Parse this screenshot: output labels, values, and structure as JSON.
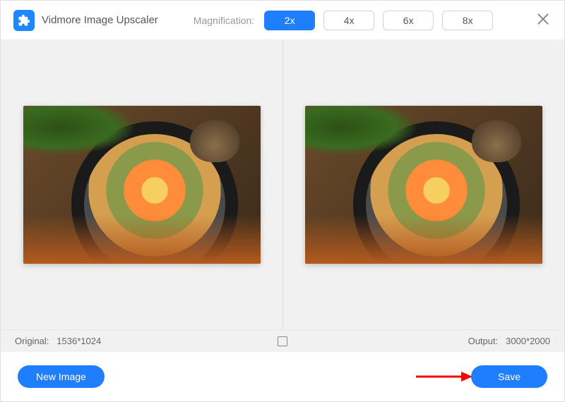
{
  "app": {
    "title": "Vidmore Image Upscaler"
  },
  "magnification": {
    "label": "Magnification:",
    "options": [
      "2x",
      "4x",
      "6x",
      "8x"
    ],
    "selected": "2x"
  },
  "info": {
    "original_label": "Original:",
    "original_size": "1536*1024",
    "output_label": "Output:",
    "output_size": "3000*2000"
  },
  "footer": {
    "new_image_label": "New Image",
    "save_label": "Save"
  }
}
